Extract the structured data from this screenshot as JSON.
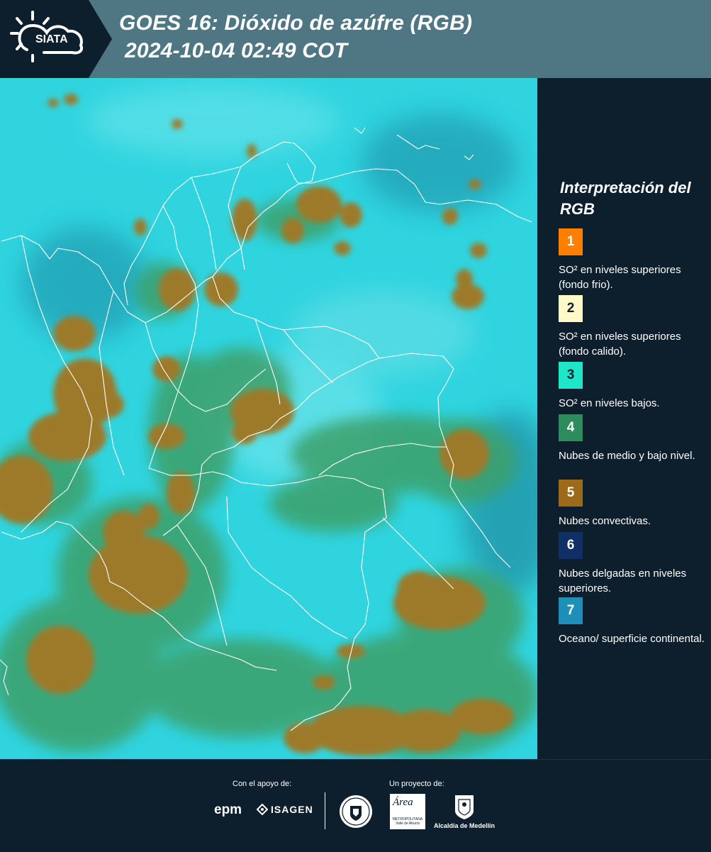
{
  "header": {
    "logo_text": "SIATA",
    "title_line1": "GOES 16: Dióxido de azúfre (RGB)",
    "title_line2": "2024-10-04 02:49 COT"
  },
  "map": {
    "colors": {
      "ocean_land": "#2fd4df",
      "low_clouds": "#3ea06a",
      "convective": "#9c7a2c",
      "thin_high": "#1e5a7a",
      "borders": "#ffffff"
    }
  },
  "legend": {
    "title": "Interpretación del RGB",
    "items": [
      {
        "number": "1",
        "color": "#ff7f00",
        "label": "SO² en niveles superiores (fondo frio)."
      },
      {
        "number": "2",
        "color": "#fff8c8",
        "label": "SO² en niveles superiores (fondo calido)."
      },
      {
        "number": "3",
        "color": "#1fe6c8",
        "label": "SO² en niveles bajos."
      },
      {
        "number": "4",
        "color": "#2e8b5e",
        "label": "Nubes de medio y bajo nivel."
      },
      {
        "number": "5",
        "color": "#9c6a18",
        "label": "Nubes convectivas."
      },
      {
        "number": "6",
        "color": "#0f2f66",
        "label": "Nubes delgadas en niveles superiores."
      },
      {
        "number": "7",
        "color": "#1e8fb8",
        "label": "Oceano/ superficie continental."
      }
    ]
  },
  "footer": {
    "support_label": "Con el apoyo de:",
    "project_label": "Un proyecto de:",
    "epm": "epm",
    "isagen": "ISAGEN",
    "area_name": "Área",
    "area_sub": "METROPOLITANA Valle de Aburrá",
    "alcaldia": "Alcaldía de Medellín"
  }
}
